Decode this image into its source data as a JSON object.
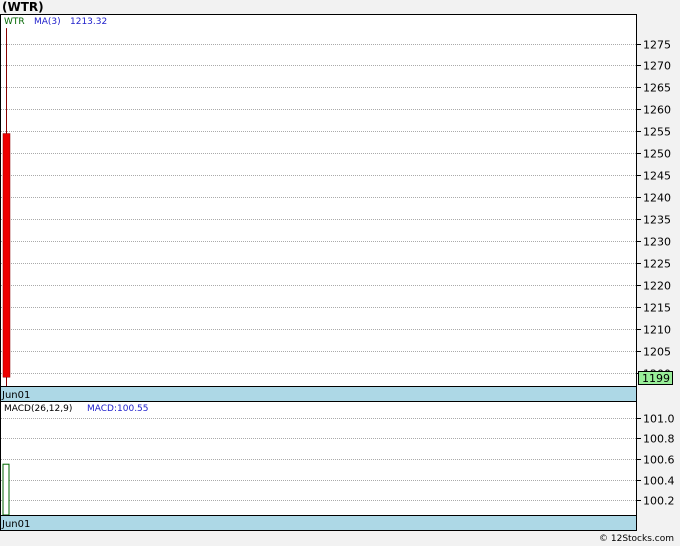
{
  "title": "(WTR)",
  "copyright": "© 12Stocks.com",
  "colors": {
    "background": "#f2f2f2",
    "panel": "#ffffff",
    "grid": "#aaaaaa",
    "date_band": "#add8e6",
    "candle_down": "#ee0000",
    "wick": "#880000",
    "macd_bar": "#006600",
    "price_badge": "#99ee99",
    "legend_symbol": "#006600",
    "legend_ma": "#2222cc"
  },
  "price_panel": {
    "legend": {
      "symbol": "WTR",
      "ma_label": "MA(3)",
      "ma_value": "1213.32"
    },
    "last_price_label": "1199",
    "date_label": "Jun01"
  },
  "macd_panel": {
    "legend": {
      "label": "MACD(26,12,9)",
      "value_text": "MACD:100.55"
    },
    "date_label": "Jun01"
  },
  "chart_data": [
    {
      "type": "candlestick",
      "title": "",
      "ylim": [
        1197,
        1281.5
      ],
      "yticks": [
        1200,
        1205,
        1210,
        1215,
        1220,
        1225,
        1230,
        1235,
        1240,
        1245,
        1250,
        1255,
        1260,
        1265,
        1270,
        1275
      ],
      "x": [
        "Jun01"
      ],
      "ohlc": [
        {
          "date": "Jun01",
          "open": 1254.5,
          "high": 1278.5,
          "low": 1197,
          "close": 1199
        }
      ],
      "moving_average": {
        "name": "MA(3)",
        "value": 1213.32
      },
      "grid": true
    },
    {
      "type": "bar",
      "title": "",
      "ylim": [
        100.06,
        101.15
      ],
      "yticks": [
        100.2,
        100.4,
        100.6,
        100.8,
        101.0
      ],
      "x": [
        "Jun01"
      ],
      "values": [
        100.55
      ],
      "series_label": "MACD(26,12,9)",
      "grid": true
    }
  ]
}
